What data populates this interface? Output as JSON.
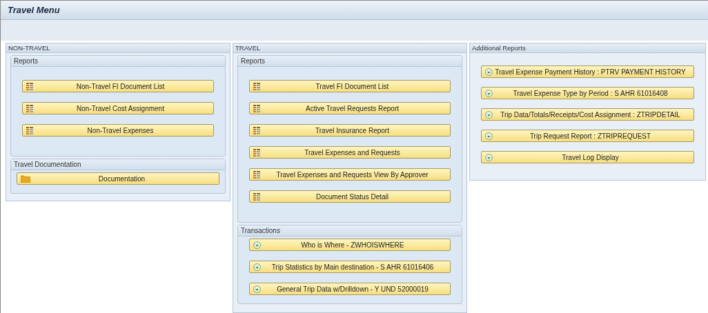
{
  "window": {
    "title": "Travel Menu"
  },
  "columns": [
    {
      "title": "NON-TRAVEL",
      "groups": [
        {
          "title": "Reports",
          "buttons": [
            {
              "label": "Non-Travel FI Document List",
              "kind": "report"
            },
            {
              "label": "Non-Travel Cost Assignment",
              "kind": "report"
            },
            {
              "label": "Non-Travel Expenses",
              "kind": "report"
            }
          ]
        },
        {
          "title": "Travel Documentation",
          "buttons": [
            {
              "label": "Documentation",
              "kind": "folder"
            }
          ]
        }
      ]
    },
    {
      "title": "TRAVEL",
      "groups": [
        {
          "title": "Reports",
          "buttons": [
            {
              "label": "Travel FI Document List",
              "kind": "report"
            },
            {
              "label": "Active Travel Requests Report",
              "kind": "report"
            },
            {
              "label": "Travel Insurance Report",
              "kind": "report"
            },
            {
              "label": "Travel Expenses and Requests",
              "kind": "report"
            },
            {
              "label": "Travel Expenses and Requests View By Approver",
              "kind": "report"
            },
            {
              "label": "Document Status Detail",
              "kind": "report"
            }
          ]
        },
        {
          "title": "Transactions",
          "buttons": [
            {
              "label": "Who is Where - ZWHOISWHERE",
              "kind": "transaction"
            },
            {
              "label": "Trip Statistics by Main destination - S AHR 61016406",
              "kind": "transaction"
            },
            {
              "label": "General Trip Data w/Drilldown - Y UND 52000019",
              "kind": "transaction"
            }
          ]
        }
      ]
    },
    {
      "title": "Additional Reports",
      "buttons": [
        {
          "label": "Travel Expense Payment History : PTRV PAYMENT HISTORY",
          "kind": "transaction"
        },
        {
          "label": "Travel Expense Type by Period : S AHR 61016408",
          "kind": "transaction"
        },
        {
          "label": "Trip Data/Totals/Receipts/Cost Assignment : ZTRIPDETAIL",
          "kind": "transaction"
        },
        {
          "label": "Trip Request Report : ZTRIPREQUEST",
          "kind": "transaction"
        },
        {
          "label": "Travel Log Display",
          "kind": "transaction"
        }
      ]
    }
  ]
}
